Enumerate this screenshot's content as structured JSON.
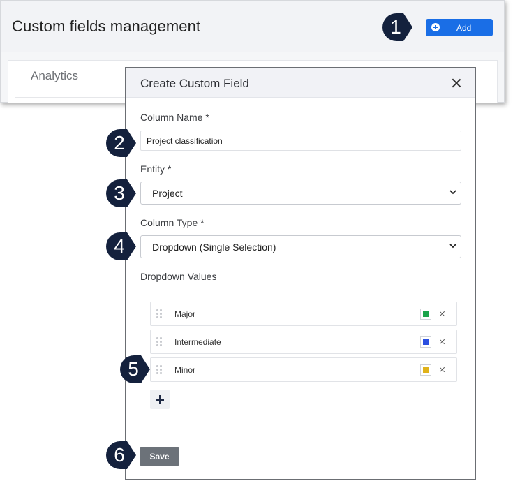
{
  "page": {
    "title": "Custom fields management",
    "add_button_label": "Add",
    "analytics_label": "Analytics"
  },
  "modal": {
    "title": "Create Custom Field",
    "column_name": {
      "label": "Column Name *",
      "value": "Project classification"
    },
    "entity": {
      "label": "Entity *",
      "selected": "Project"
    },
    "column_type": {
      "label": "Column Type *",
      "selected": "Dropdown (Single Selection)"
    },
    "dropdown_values": {
      "label": "Dropdown Values",
      "items": [
        {
          "label": "Major",
          "color": "#1aa34a"
        },
        {
          "label": "Intermediate",
          "color": "#2b4fe0"
        },
        {
          "label": "Minor",
          "color": "#e0b21a"
        }
      ]
    },
    "save_label": "Save"
  },
  "steps": [
    "1",
    "2",
    "3",
    "4",
    "5",
    "6"
  ],
  "colors": {
    "accent": "#1a6ee6",
    "step_marker": "#14213d",
    "save_button": "#6c7279"
  }
}
